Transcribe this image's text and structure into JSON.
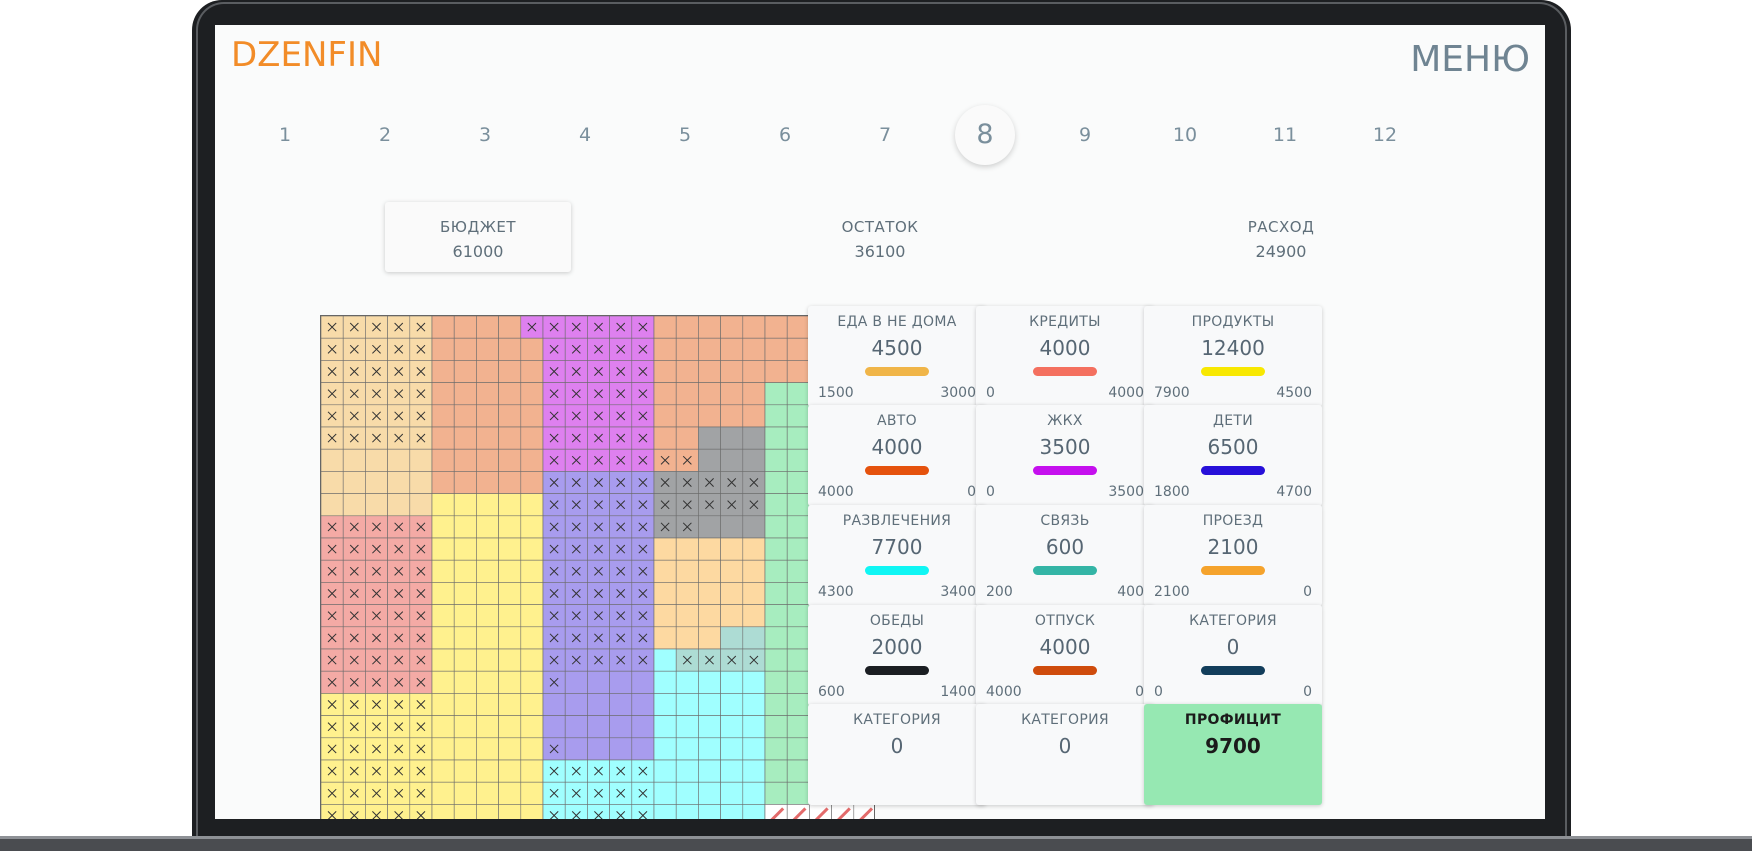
{
  "app": {
    "logo": "DZENFIN",
    "menu_label": "МЕНЮ"
  },
  "months": [
    "1",
    "2",
    "3",
    "4",
    "5",
    "6",
    "7",
    "8",
    "9",
    "10",
    "11",
    "12"
  ],
  "active_month": "8",
  "summary": {
    "budget": {
      "label": "БЮДЖЕТ",
      "value": "61000"
    },
    "remaining": {
      "label": "ОСТАТОК",
      "value": "36100"
    },
    "expense": {
      "label": "РАСХОД",
      "value": "24900"
    }
  },
  "categories": [
    {
      "name": "ЕДА В НЕ ДОМА",
      "amount": "4500",
      "color": "#f0b548",
      "lo": "1500",
      "hi": "3000"
    },
    {
      "name": "КРЕДИТЫ",
      "amount": "4000",
      "color": "#f4705f",
      "lo": "0",
      "hi": "4000"
    },
    {
      "name": "ПРОДУКТЫ",
      "amount": "12400",
      "color": "#f8e801",
      "lo": "7900",
      "hi": "4500"
    },
    {
      "name": "АВТО",
      "amount": "4000",
      "color": "#e5520d",
      "lo": "4000",
      "hi": "0"
    },
    {
      "name": "ЖКХ",
      "amount": "3500",
      "color": "#c510ee",
      "lo": "0",
      "hi": "3500"
    },
    {
      "name": "ДЕТИ",
      "amount": "6500",
      "color": "#2710d9",
      "lo": "1800",
      "hi": "4700"
    },
    {
      "name": "РАЗВЛЕЧЕНИЯ",
      "amount": "7700",
      "color": "#10f6f4",
      "lo": "4300",
      "hi": "3400"
    },
    {
      "name": "СВЯЗЬ",
      "amount": "600",
      "color": "#34b5a6",
      "lo": "200",
      "hi": "400"
    },
    {
      "name": "ПРОЕЗД",
      "amount": "2100",
      "color": "#f5a32c",
      "lo": "2100",
      "hi": "0"
    },
    {
      "name": "ОБЕДЫ",
      "amount": "2000",
      "color": "#1b1e22",
      "lo": "600",
      "hi": "1400"
    },
    {
      "name": "ОТПУСК",
      "amount": "4000",
      "color": "#cf4c0c",
      "lo": "4000",
      "hi": "0"
    },
    {
      "name": "КАТЕГОРИЯ",
      "amount": "0",
      "color": "#133e5b",
      "lo": "0",
      "hi": "0"
    },
    {
      "name": "КАТЕГОРИЯ",
      "amount": "0"
    },
    {
      "name": "КАТЕГОРИЯ",
      "amount": "0"
    }
  ],
  "surplus": {
    "label": "ПРОФИЦИТ",
    "value": "9700",
    "color": "#96e8b2"
  },
  "grid_colors": {
    "tan": "#f8dba9",
    "salmon": "#f2b290",
    "purple": "#de80ef",
    "gray": "#a1a3a5",
    "green": "#a7edbf",
    "pink": "#f4aaa5",
    "yellow": "#fff18e",
    "blue": "#a89cee",
    "peach": "#fdd9a1",
    "teal": "#addcd4",
    "cyan": "#a0ffff"
  }
}
